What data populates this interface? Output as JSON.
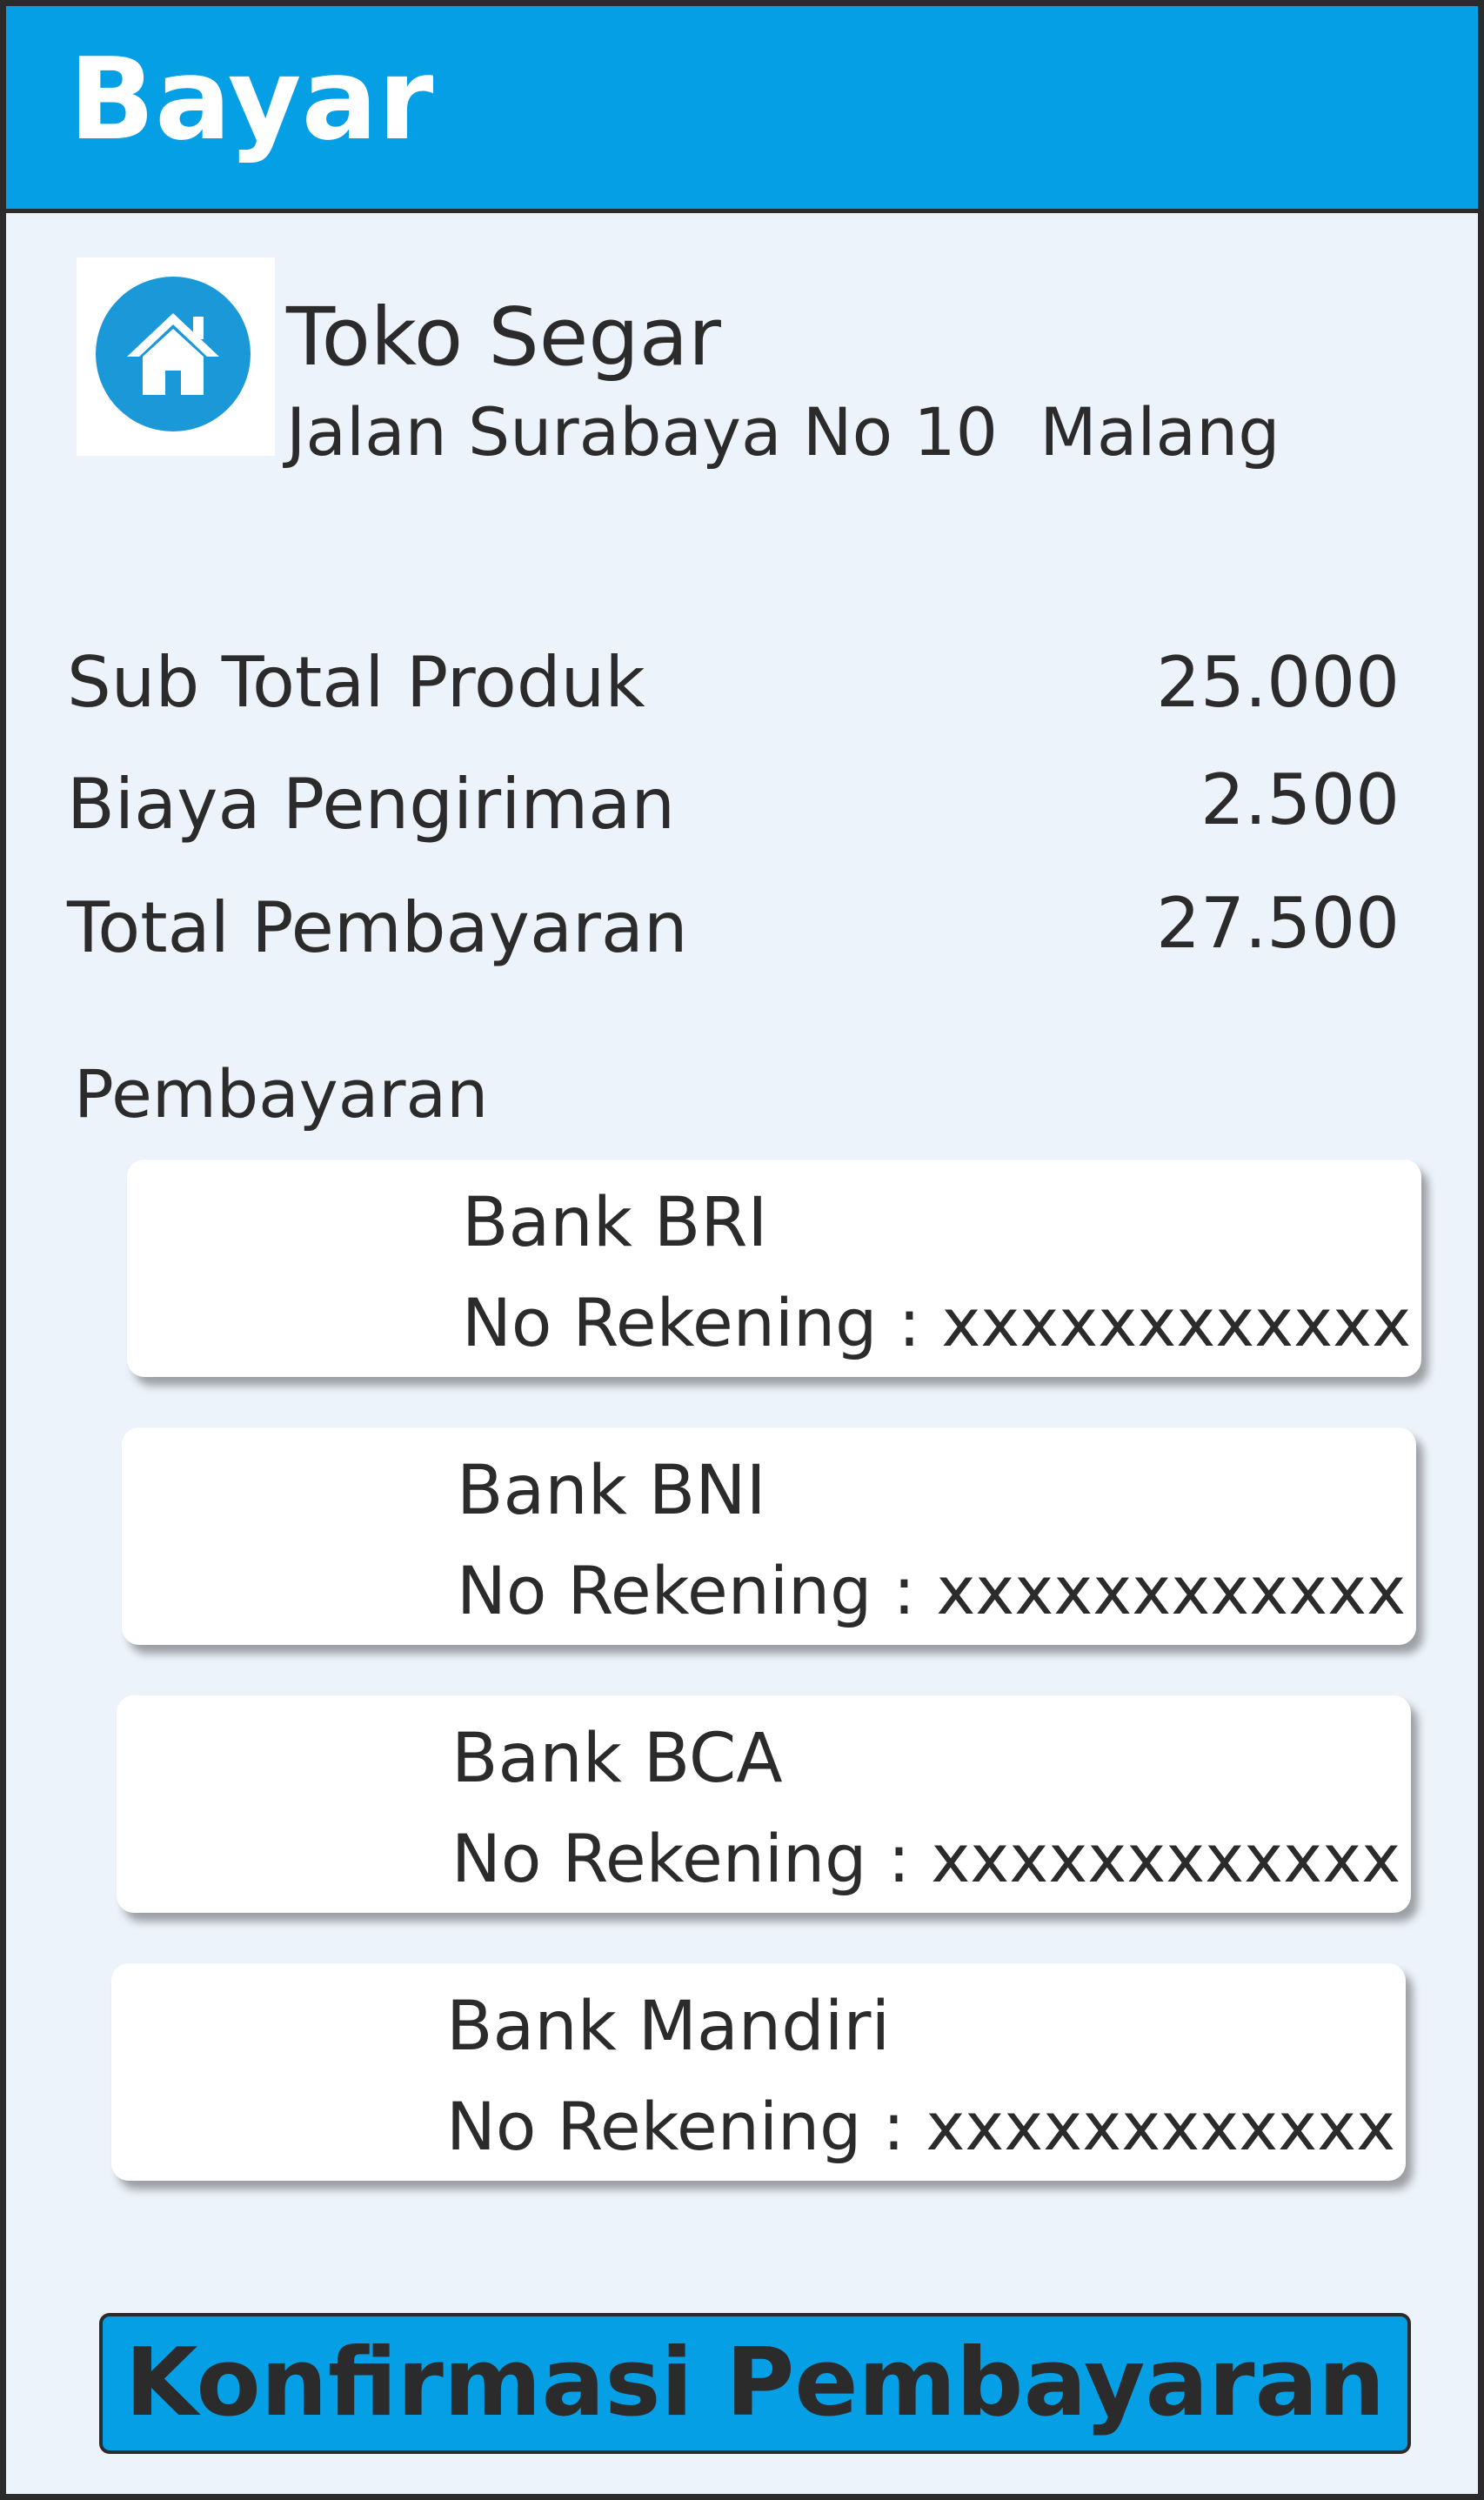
{
  "header": {
    "title": "Bayar"
  },
  "store": {
    "icon": "home-icon",
    "name": "Toko Segar",
    "address": "Jalan Surabaya No 10  Malang"
  },
  "summary": [
    {
      "label": "Sub Total Produk",
      "value": "25.000"
    },
    {
      "label": "Biaya Pengiriman",
      "value": "2.500"
    },
    {
      "label": "Total Pembayaran",
      "value": "27.500"
    }
  ],
  "payment": {
    "label": "Pembayaran",
    "banks": [
      {
        "name": "Bank BRI",
        "account": "No Rekening : xxxxxxxxxxxx"
      },
      {
        "name": "Bank BNI",
        "account": "No Rekening : xxxxxxxxxxxx"
      },
      {
        "name": "Bank BCA",
        "account": "No Rekening : xxxxxxxxxxxx"
      },
      {
        "name": "Bank Mandiri",
        "account": "No Rekening : xxxxxxxxxxxx"
      }
    ]
  },
  "confirm_button": {
    "label": "Konfirmasi Pembayaran"
  },
  "colors": {
    "accent": "#059fe6",
    "background": "#edf3fa",
    "text": "#2b2b2b",
    "card": "#ffffff"
  }
}
